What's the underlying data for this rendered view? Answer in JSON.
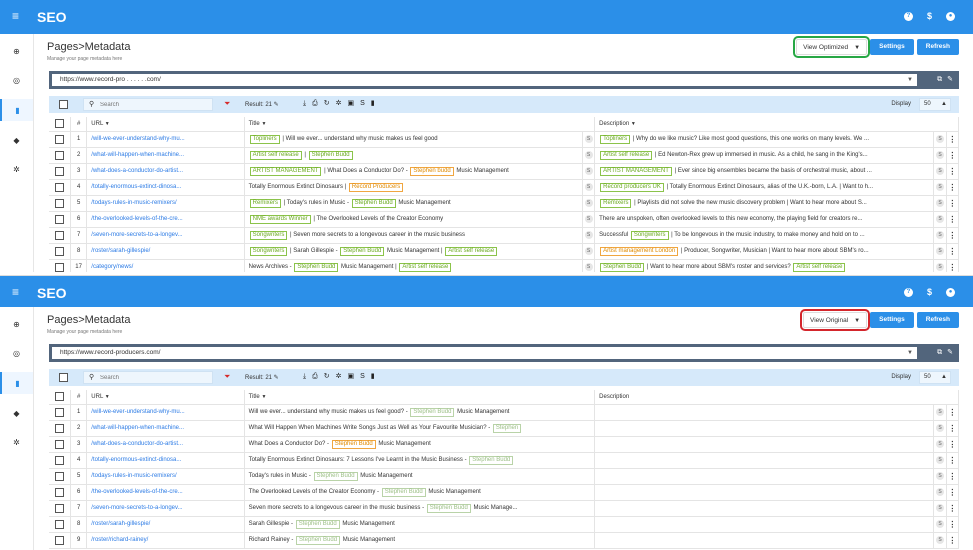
{
  "app": {
    "title": "SEO",
    "menu_icon": "menu-icon",
    "top_icons": [
      "help-icon",
      "dollar-icon",
      "user-icon"
    ]
  },
  "sidebar": {
    "items": [
      {
        "icon": "globe-icon",
        "glyph": "⊕"
      },
      {
        "icon": "target-icon",
        "glyph": "◎"
      },
      {
        "icon": "document-icon",
        "glyph": "▮",
        "active": true
      },
      {
        "icon": "tag-icon",
        "glyph": "◆"
      },
      {
        "icon": "settings-icon",
        "glyph": "✲"
      }
    ]
  },
  "common": {
    "page_title": "Pages>Metadata",
    "page_subtitle": "Manage your page metadata here",
    "settings_label": "Settings",
    "refresh_label": "Refresh",
    "search_placeholder": "Search",
    "result_label": "Result: 21",
    "display_label": "Display",
    "display_value": "50",
    "col_num": "#",
    "col_url": "URL",
    "col_title": "Title",
    "col_desc": "Description"
  },
  "panel1": {
    "view_label": "View Optimized",
    "url_value": "https://www.record-pro . . . . . .com/",
    "rows": [
      {
        "n": "1",
        "url": "/will-we-ever-understand-why-mu...",
        "title": [
          {
            "t": "tag",
            "v": "Topliners"
          },
          {
            "t": "text",
            "v": " | Will we ever... understand why music makes us feel good"
          }
        ],
        "desc": [
          {
            "t": "tag",
            "v": "Topliners"
          },
          {
            "t": "text",
            "v": " | Why do we like music? Like most good questions, this one works on many levels. We ..."
          }
        ]
      },
      {
        "n": "2",
        "url": "/what-will-happen-when-machine...",
        "title": [
          {
            "t": "tag",
            "v": "Artist self release"
          },
          {
            "t": "text",
            "v": " | "
          },
          {
            "t": "tag",
            "v": "Stephen Budd"
          }
        ],
        "desc": [
          {
            "t": "tag",
            "v": "Artist self release"
          },
          {
            "t": "text",
            "v": " | Ed Newton-Rex grew up immersed in music. As a child, he sang in the King's..."
          }
        ]
      },
      {
        "n": "3",
        "url": "/what-does-a-conductor-do-artist...",
        "title": [
          {
            "t": "tag",
            "v": "ARTIST MANAGEMENT"
          },
          {
            "t": "text",
            "v": " | What Does a Conductor Do? - "
          },
          {
            "t": "tago",
            "v": "Stephen budd"
          },
          {
            "t": "text",
            "v": " Music Management"
          }
        ],
        "desc": [
          {
            "t": "tag",
            "v": "ARTIST MANAGEMENT"
          },
          {
            "t": "text",
            "v": " | Ever since big ensembles became the basis of orchestral music, about ..."
          }
        ]
      },
      {
        "n": "4",
        "url": "/totally-enormous-extinct-dinosa...",
        "title": [
          {
            "t": "text",
            "v": "Totally Enormous Extinct Dinosaurs | "
          },
          {
            "t": "tago",
            "v": "Record Producers"
          }
        ],
        "desc": [
          {
            "t": "tag",
            "v": "Record producers UK"
          },
          {
            "t": "text",
            "v": " | Totally Enormous Extinct Dinosaurs, alias of the U.K.-born, L.A. | Want to h..."
          }
        ]
      },
      {
        "n": "5",
        "url": "/todays-rules-in-music-remixers/",
        "title": [
          {
            "t": "tag",
            "v": "Remixers"
          },
          {
            "t": "text",
            "v": " | Today's rules in Music - "
          },
          {
            "t": "tag",
            "v": "Stephen Budd"
          },
          {
            "t": "text",
            "v": " Music Management"
          }
        ],
        "desc": [
          {
            "t": "tag",
            "v": "Remixers"
          },
          {
            "t": "text",
            "v": " | Playlists did not solve the new music discovery problem | Want to hear more about S..."
          }
        ]
      },
      {
        "n": "6",
        "url": "/the-overlooked-levels-of-the-cre...",
        "title": [
          {
            "t": "tag",
            "v": "NME awards Winner"
          },
          {
            "t": "text",
            "v": " | The Overlooked Levels of the Creator Economy"
          }
        ],
        "desc": [
          {
            "t": "text",
            "v": "There are unspoken, often overlooked levels to this new economy, the playing field for creators re..."
          }
        ]
      },
      {
        "n": "7",
        "url": "/seven-more-secrets-to-a-longev...",
        "title": [
          {
            "t": "tag",
            "v": "Songwriters"
          },
          {
            "t": "text",
            "v": " | Seven more secrets to a longevous career in the music business"
          }
        ],
        "desc": [
          {
            "t": "text",
            "v": "Successful "
          },
          {
            "t": "tag",
            "v": "Songwriters"
          },
          {
            "t": "text",
            "v": " | To be longevous in the music industry, to make money and hold on to ..."
          }
        ]
      },
      {
        "n": "8",
        "url": "/roster/sarah-gillespie/",
        "title": [
          {
            "t": "tag",
            "v": "Songwriters"
          },
          {
            "t": "text",
            "v": " | Sarah Gillespie - "
          },
          {
            "t": "tag",
            "v": "Stephen Budd"
          },
          {
            "t": "text",
            "v": " Music Management | "
          },
          {
            "t": "tag",
            "v": "Artist self release"
          }
        ],
        "desc": [
          {
            "t": "tago",
            "v": "Artist management London"
          },
          {
            "t": "text",
            "v": " | Producer, Songwriter, Musician | Want to hear more about SBM's ro..."
          }
        ]
      },
      {
        "n": "17",
        "url": "/category/news/",
        "title": [
          {
            "t": "text",
            "v": "News Archives - "
          },
          {
            "t": "tag",
            "v": "Stephen Budd"
          },
          {
            "t": "text",
            "v": " Music Management | "
          },
          {
            "t": "tag",
            "v": "Artist self release"
          }
        ],
        "desc": [
          {
            "t": "tag",
            "v": "Stephen Budd"
          },
          {
            "t": "text",
            "v": " | Want to hear more about SBM's roster and services? "
          },
          {
            "t": "tag",
            "v": "Artist self release"
          }
        ]
      }
    ]
  },
  "panel2": {
    "view_label": "View Original",
    "url_value": "https://www.record-producers.com/",
    "rows": [
      {
        "n": "1",
        "url": "/will-we-ever-understand-why-mu...",
        "title": [
          {
            "t": "text",
            "v": "Will we ever... understand why music makes us feel good? - "
          },
          {
            "t": "tagg",
            "v": "Stephen Budd"
          },
          {
            "t": "text",
            "v": " Music Management"
          }
        ],
        "desc": []
      },
      {
        "n": "2",
        "url": "/what-will-happen-when-machine...",
        "title": [
          {
            "t": "text",
            "v": "What Will Happen When Machines Write Songs Just as Well as Your Favourite Musician? - "
          },
          {
            "t": "tagg",
            "v": "Stephen"
          }
        ],
        "desc": []
      },
      {
        "n": "3",
        "url": "/what-does-a-conductor-do-artist...",
        "title": [
          {
            "t": "text",
            "v": "What Does a Conductor Do? - "
          },
          {
            "t": "tago",
            "v": "Stephen Budd"
          },
          {
            "t": "text",
            "v": " Music Management"
          }
        ],
        "desc": []
      },
      {
        "n": "4",
        "url": "/totally-enormous-extinct-dinosa...",
        "title": [
          {
            "t": "text",
            "v": "Totally Enormous Extinct Dinosaurs: 7 Lessons I've Learnt in the Music Business - "
          },
          {
            "t": "tagg",
            "v": "Stephen Budd"
          }
        ],
        "desc": []
      },
      {
        "n": "5",
        "url": "/todays-rules-in-music-remixers/",
        "title": [
          {
            "t": "text",
            "v": "Today's rules in Music - "
          },
          {
            "t": "tagg",
            "v": "Stephen Budd"
          },
          {
            "t": "text",
            "v": " Music Management"
          }
        ],
        "desc": []
      },
      {
        "n": "6",
        "url": "/the-overlooked-levels-of-the-cre...",
        "title": [
          {
            "t": "text",
            "v": "The Overlooked Levels of the Creator Economy - "
          },
          {
            "t": "tagg",
            "v": "Stephen Budd"
          },
          {
            "t": "text",
            "v": " Music Management"
          }
        ],
        "desc": []
      },
      {
        "n": "7",
        "url": "/seven-more-secrets-to-a-longev...",
        "title": [
          {
            "t": "text",
            "v": "Seven more secrets to a longevous career in the music business - "
          },
          {
            "t": "tagg",
            "v": "Stephen Budd"
          },
          {
            "t": "text",
            "v": " Music Manage..."
          }
        ],
        "desc": []
      },
      {
        "n": "8",
        "url": "/roster/sarah-gillespie/",
        "title": [
          {
            "t": "text",
            "v": "Sarah Gillespie - "
          },
          {
            "t": "tagg",
            "v": "Stephen Budd"
          },
          {
            "t": "text",
            "v": " Music Management"
          }
        ],
        "desc": []
      },
      {
        "n": "9",
        "url": "/roster/richard-rainey/",
        "title": [
          {
            "t": "text",
            "v": "Richard Rainey - "
          },
          {
            "t": "tagg",
            "v": "Stephen Budd"
          },
          {
            "t": "text",
            "v": " Music Management"
          }
        ],
        "desc": []
      }
    ]
  },
  "colors": {
    "topbar": "#2b8fe8",
    "url_bar": "#52657c",
    "toolbar": "#d6e9fa",
    "highlight_green": "#27a745",
    "highlight_red": "#d4262c"
  }
}
